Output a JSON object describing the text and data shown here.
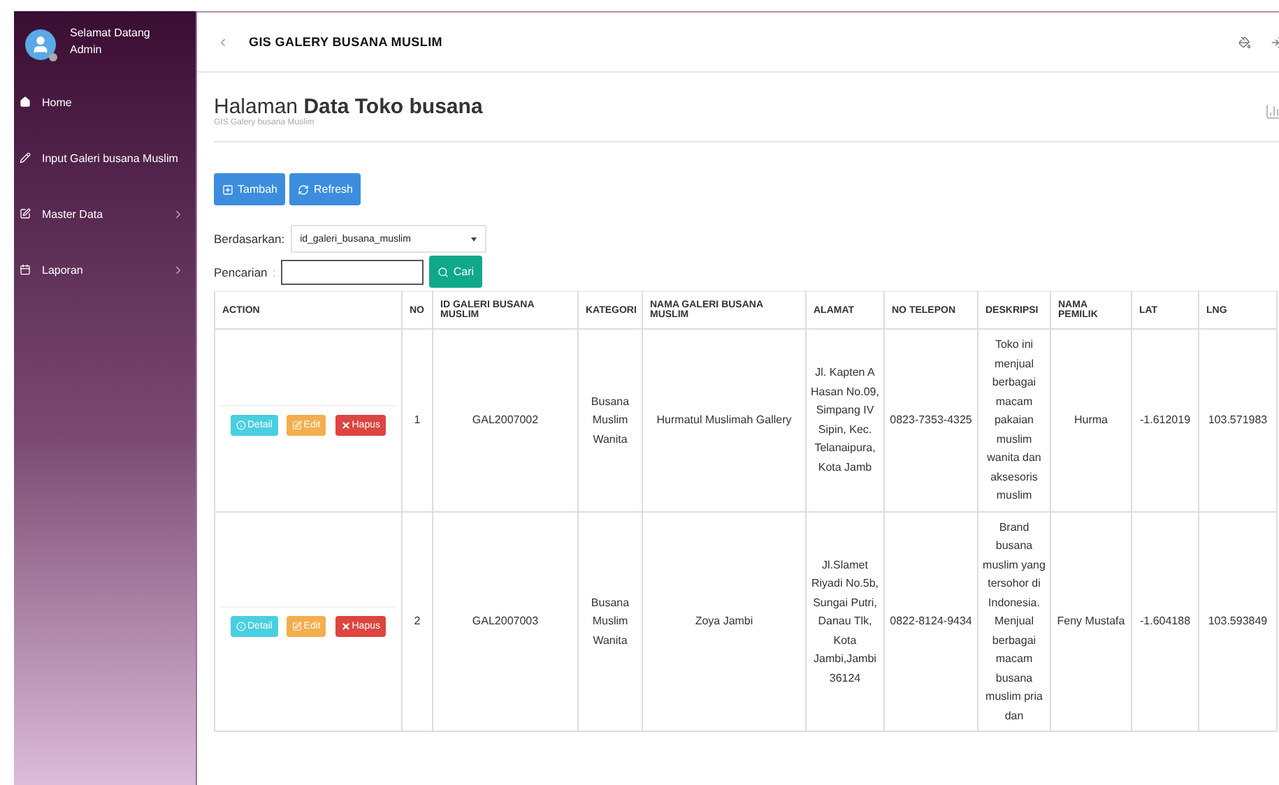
{
  "sidebar": {
    "greeting": "Selamat Datang",
    "user": "Admin",
    "items": [
      {
        "label": "Home",
        "kind": "home"
      },
      {
        "label": "Input Galeri busana Muslim",
        "kind": "input"
      },
      {
        "label": "Master Data",
        "kind": "master"
      },
      {
        "label": "Laporan",
        "kind": "report"
      }
    ]
  },
  "header": {
    "title": "GIS GALERY BUSANA MUSLIM"
  },
  "page": {
    "title_light": "Halaman",
    "title_bold": "Data Toko busana",
    "subtitle": "GIS Galery busana Muslim"
  },
  "toolbar": [
    {
      "label": "Tambah",
      "kind": "add"
    },
    {
      "label": "Refresh",
      "kind": "refresh"
    }
  ],
  "filter": {
    "label": "Berdasarkan:",
    "value": "id_galeri_busana_muslim"
  },
  "search": {
    "label": "Pencarian",
    "separator": ":",
    "button": "Cari"
  },
  "table": {
    "columns": [
      "ACTION",
      "NO",
      "ID GALERI BUSANA MUSLIM",
      "KATEGORI",
      "NAMA GALERI BUSANA MUSLIM",
      "ALAMAT",
      "NO TELEPON",
      "DESKRIPSI",
      "NAMA PEMILIK",
      "LAT",
      "LNG"
    ],
    "rows": [
      {
        "cells": [
          {
            "actions": [
              {
                "label": "Detail",
                "kind": "detail"
              },
              {
                "label": "Edit",
                "kind": "edit"
              },
              {
                "label": "Hapus",
                "kind": "delete"
              }
            ]
          },
          "1",
          "GAL2007002",
          "Busana Muslim Wanita",
          "Hurmatul Muslimah Gallery",
          "Jl. Kapten A Hasan No.09, Simpang IV Sipin, Kec. Telanaipura, Kota Jamb",
          "0823-7353-4325",
          "Toko ini menjual berbagai macam pakaian muslim wanita dan aksesoris muslim",
          "Hurma",
          "-1.612019",
          "103.571983"
        ]
      },
      {
        "cells": [
          {
            "actions": [
              {
                "label": "Detail",
                "kind": "detail"
              },
              {
                "label": "Edit",
                "kind": "edit"
              },
              {
                "label": "Hapus",
                "kind": "delete"
              }
            ]
          },
          "2",
          "GAL2007003",
          "Busana Muslim Wanita",
          "Zoya Jambi",
          "Jl.Slamet Riyadi No.5b, Sungai Putri, Danau Tlk, Kota Jambi,Jambi 36124",
          "0822-8124-9434",
          "Brand busana muslim yang tersohor di Indonesia. Menjual berbagai macam busana muslim pria dan",
          "Feny Mustafa",
          "-1.604188",
          "103.593849"
        ]
      }
    ]
  }
}
